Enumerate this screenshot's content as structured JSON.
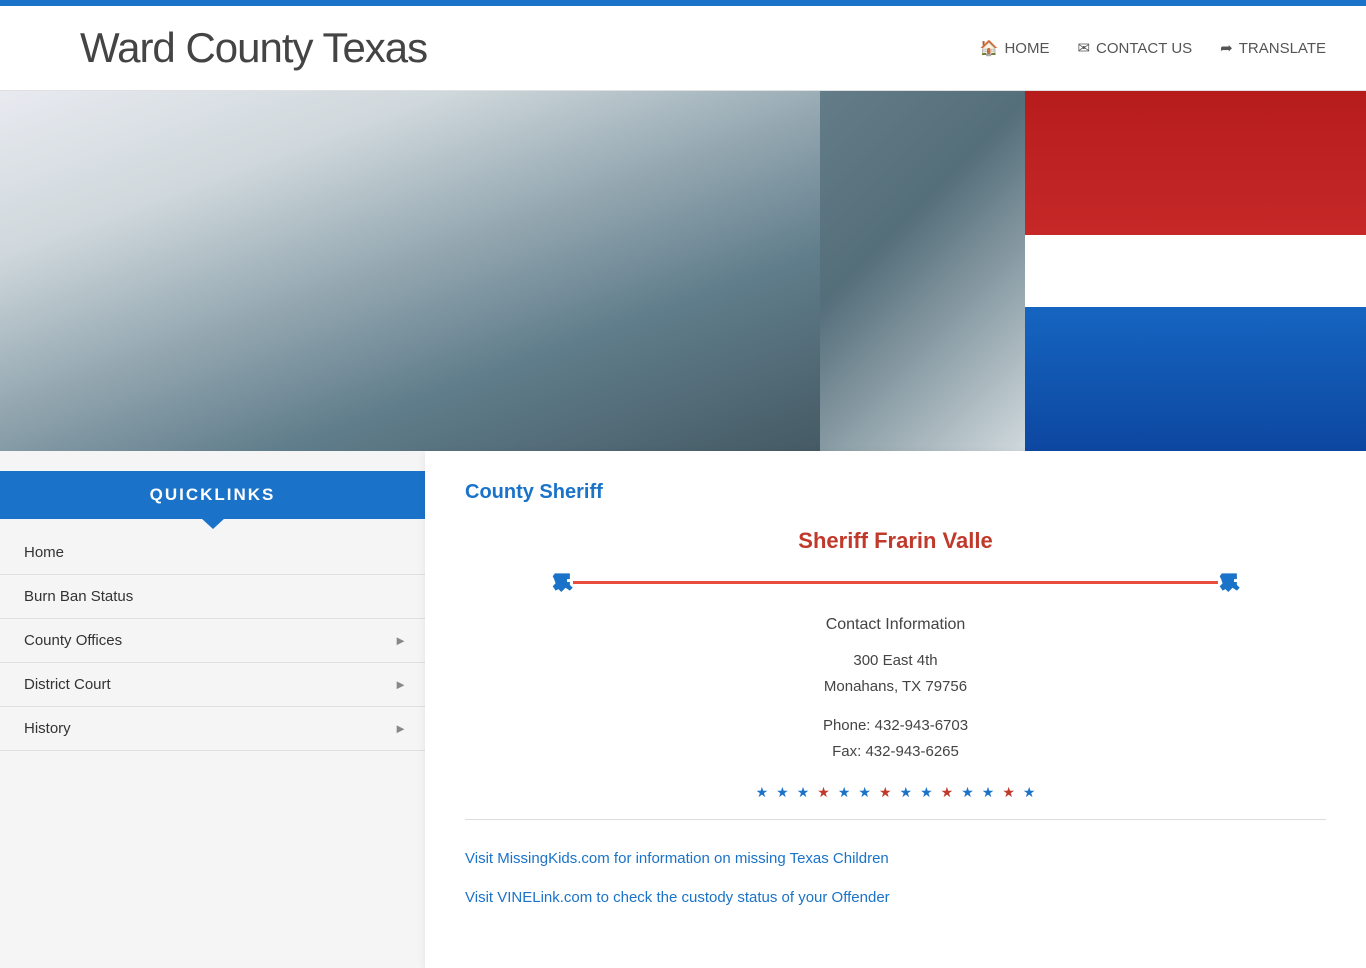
{
  "topBar": {},
  "header": {
    "siteTitle": "Ward County Texas",
    "nav": {
      "home": "HOME",
      "contactUs": "CONTACT US",
      "translate": "TRANSLATE"
    }
  },
  "sidebar": {
    "quicklinksLabel": "QUICKLINKS",
    "items": [
      {
        "label": "Home",
        "hasArrow": false
      },
      {
        "label": "Burn Ban Status",
        "hasArrow": false
      },
      {
        "label": "County Offices",
        "hasArrow": true
      },
      {
        "label": "District Court",
        "hasArrow": true
      },
      {
        "label": "History",
        "hasArrow": true
      }
    ]
  },
  "content": {
    "sectionTitle": "County Sheriff",
    "sheriffName": "Sheriff Frarin Valle",
    "contactLabel": "Contact Information",
    "address1": "300 East 4th",
    "address2": "Monahans, TX 79756",
    "phone": "Phone: 432-943-6703",
    "fax": "Fax: 432-943-6265",
    "link1": "Visit MissingKids.com for information on missing Texas Children",
    "link2": "Visit VINELink.com to check the custody status of your Offender"
  }
}
